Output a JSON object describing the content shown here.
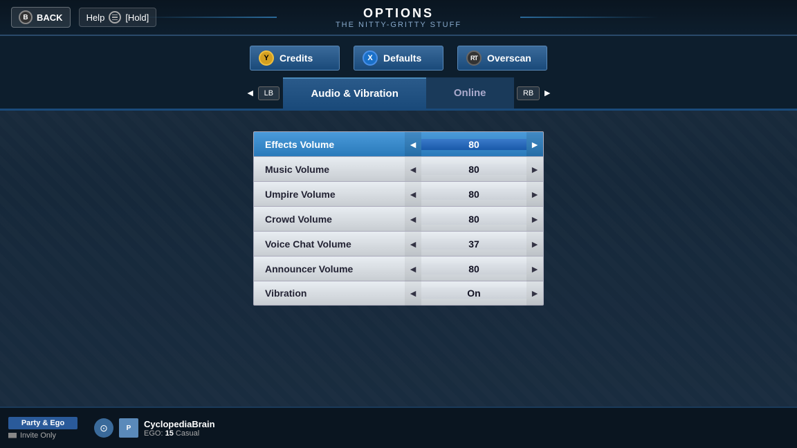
{
  "header": {
    "back_label": "BACK",
    "back_btn": "B",
    "help_label": "Help",
    "hold_label": "[Hold]",
    "title": "OPTIONS",
    "subtitle": "THE NITTY-GRITTY STUFF"
  },
  "top_buttons": [
    {
      "id": "credits",
      "btn": "Y",
      "label": "Credits"
    },
    {
      "id": "defaults",
      "btn": "X",
      "label": "Defaults"
    },
    {
      "id": "overscan",
      "btn": "RT",
      "label": "Overscan"
    }
  ],
  "nav": {
    "left_btn": "LB",
    "right_btn": "RB",
    "tabs": [
      {
        "id": "audio",
        "label": "Audio & Vibration",
        "active": true
      },
      {
        "id": "online",
        "label": "Online",
        "active": false
      }
    ]
  },
  "settings": [
    {
      "id": "effects-volume",
      "name": "Effects Volume",
      "value": "80",
      "active": true
    },
    {
      "id": "music-volume",
      "name": "Music Volume",
      "value": "80",
      "active": false
    },
    {
      "id": "umpire-volume",
      "name": "Umpire Volume",
      "value": "80",
      "active": false
    },
    {
      "id": "crowd-volume",
      "name": "Crowd Volume",
      "value": "80",
      "active": false
    },
    {
      "id": "voice-chat-volume",
      "name": "Voice Chat Volume",
      "value": "37",
      "active": false
    },
    {
      "id": "announcer-volume",
      "name": "Announcer Volume",
      "value": "80",
      "active": false
    },
    {
      "id": "vibration",
      "name": "Vibration",
      "value": "On",
      "active": false
    }
  ],
  "bottom_bar": {
    "party_label": "Party & Ego",
    "invite_label": "Invite Only",
    "player_name": "CyclopediaBrain",
    "ego_label": "EGO:",
    "ego_value": "15",
    "ego_level": "Casual"
  }
}
